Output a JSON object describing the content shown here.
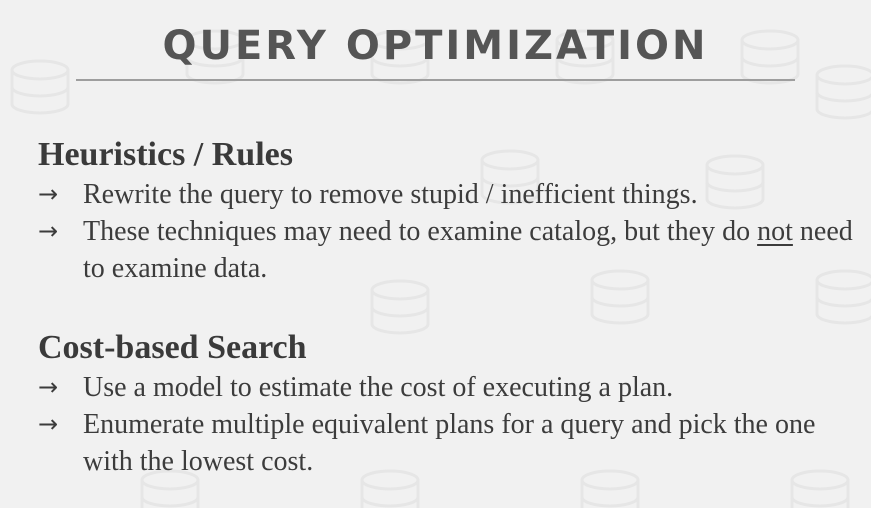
{
  "slide": {
    "title": "QUERY OPTIMIZATION",
    "arrow_glyph": "→",
    "sections": [
      {
        "heading": "Heuristics / Rules",
        "bullets": [
          {
            "text": "Rewrite the query to remove stupid / inefficient things."
          },
          {
            "text_before": "These techniques may need to examine catalog, but they do ",
            "emphasis": "not",
            "text_after": " need to examine data."
          }
        ]
      },
      {
        "heading": "Cost-based Search",
        "bullets": [
          {
            "text": "Use a model to estimate the cost of executing a plan."
          },
          {
            "text": "Enumerate multiple equivalent plans for a query and pick the one with the lowest cost."
          }
        ]
      }
    ]
  },
  "colors": {
    "background": "#f1f1f1",
    "title": "#555555",
    "text": "#3c3c3c",
    "rule": "#9e9e9e"
  }
}
